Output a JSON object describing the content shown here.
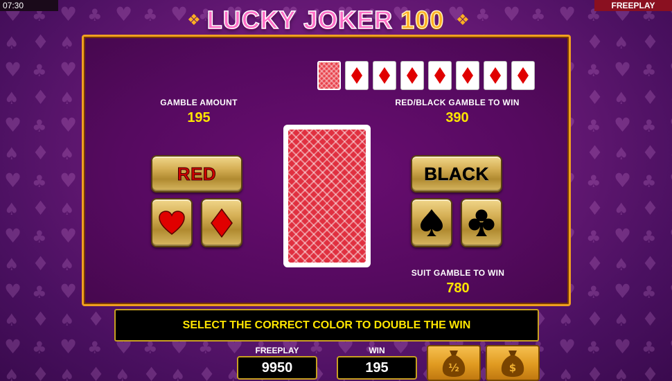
{
  "status": {
    "time": "07:30",
    "mode": "FREEPLAY"
  },
  "logo": {
    "word1": "LUCKY JOKER",
    "number": "100"
  },
  "history": {
    "count": 8
  },
  "gamble_amount": {
    "label": "GAMBLE AMOUNT",
    "value": "195"
  },
  "color_gamble": {
    "label": "RED/BLACK GAMBLE TO WIN",
    "value": "390"
  },
  "suit_gamble": {
    "label": "SUIT GAMBLE TO WIN",
    "value": "780"
  },
  "buttons": {
    "red": "RED",
    "black": "BLACK"
  },
  "message": "SELECT THE CORRECT COLOR TO DOUBLE THE WIN",
  "footer": {
    "freeplay_label": "FREEPLAY",
    "freeplay_value": "9950",
    "win_label": "WIN",
    "win_value": "195"
  },
  "colors": {
    "accent": "#f0a020",
    "panel": "#560a60",
    "value": "#ffe600",
    "red_suit": "#e00000"
  },
  "icons": [
    "heart-icon",
    "diamond-icon",
    "spade-icon",
    "club-icon",
    "money-bag-half-icon",
    "money-bag-collect-icon"
  ]
}
